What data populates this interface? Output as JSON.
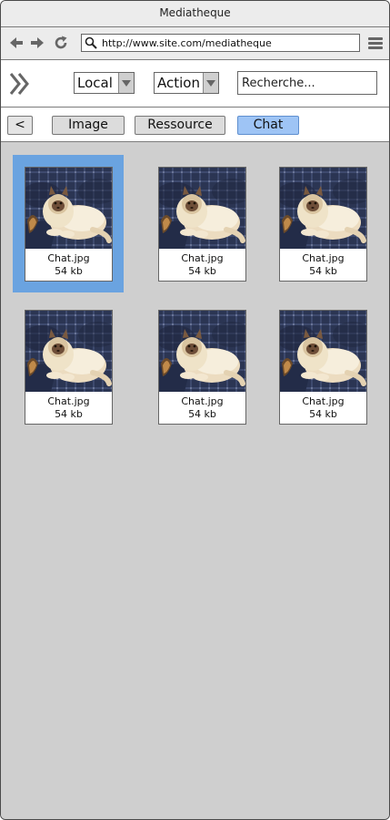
{
  "window": {
    "title": "Mediatheque"
  },
  "browser": {
    "back_icon": "arrow-left-icon",
    "forward_icon": "arrow-right-icon",
    "reload_icon": "reload-icon",
    "url": "http://www.site.com/mediatheque",
    "menu_icon": "hamburger-menu-icon"
  },
  "toolbar": {
    "expand_icon": "double-chevron-right-icon",
    "location_select": "Local",
    "action_select": "Action",
    "search_placeholder": "Recherche..."
  },
  "breadcrumb": {
    "back_label": "<",
    "items": [
      "Image",
      "Ressource",
      "Chat"
    ]
  },
  "files": [
    {
      "name": "Chat.jpg",
      "size": "54 kb",
      "selected": true
    },
    {
      "name": "Chat.jpg",
      "size": "54 kb",
      "selected": false
    },
    {
      "name": "Chat.jpg",
      "size": "54 kb",
      "selected": false
    },
    {
      "name": "Chat.jpg",
      "size": "54 kb",
      "selected": false
    },
    {
      "name": "Chat.jpg",
      "size": "54 kb",
      "selected": false
    },
    {
      "name": "Chat.jpg",
      "size": "54 kb",
      "selected": false
    }
  ],
  "colors": {
    "selection": "#6aa3e0",
    "active_tab": "#9ec4f5",
    "background": "#cfcfcf"
  }
}
